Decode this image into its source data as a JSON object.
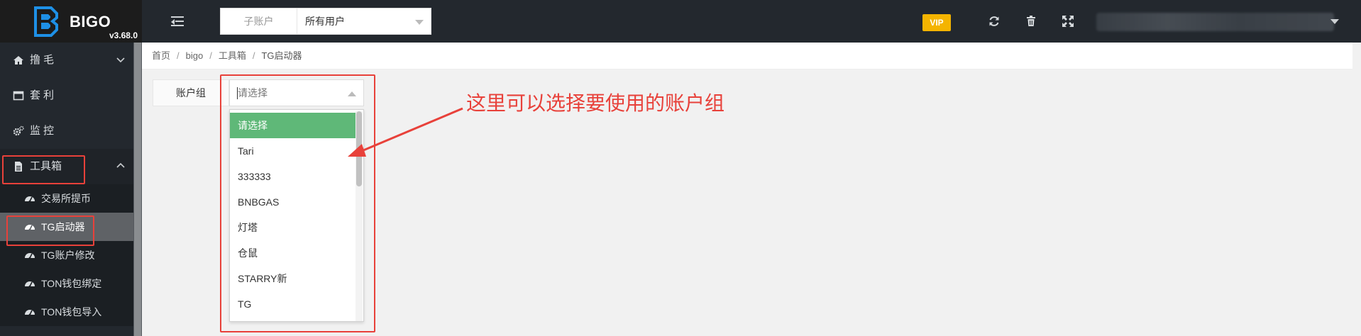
{
  "app": {
    "logo_text": "BIGO",
    "version": "v3.68.0"
  },
  "header": {
    "account_select": {
      "label": "子账户",
      "value": "所有用户"
    },
    "vip_badge": "VIP",
    "icons": [
      "refresh-icon",
      "trash-icon",
      "fullscreen-icon"
    ]
  },
  "sidebar": {
    "items": [
      {
        "label": "撸毛",
        "icon": "home-icon",
        "chevron": "down"
      },
      {
        "label": "套利",
        "icon": "window-icon"
      },
      {
        "label": "监控",
        "icon": "gears-icon"
      },
      {
        "label": "工具箱",
        "icon": "file-icon",
        "chevron": "up",
        "open": true
      }
    ],
    "sub_items": [
      {
        "label": "交易所提币",
        "icon": "dashboard-icon"
      },
      {
        "label": "TG启动器",
        "icon": "dashboard-icon",
        "active": true
      },
      {
        "label": "TG账户修改",
        "icon": "dashboard-icon"
      },
      {
        "label": "TON钱包绑定",
        "icon": "dashboard-icon"
      },
      {
        "label": "TON钱包导入",
        "icon": "dashboard-icon"
      }
    ]
  },
  "breadcrumb": [
    "首页",
    "bigo",
    "工具箱",
    "TG启动器"
  ],
  "form": {
    "account_group_label": "账户组",
    "account_group_placeholder": "请选择",
    "options": [
      "请选择",
      "Tari",
      "333333",
      "BNBGAS",
      "灯塔",
      "仓鼠",
      "STARRY新",
      "TG"
    ],
    "selected_index": 0
  },
  "annotation": {
    "text": "这里可以选择要使用的账户组",
    "color": "#e8413a"
  },
  "colors": {
    "topbar": "#23282e",
    "sidebar": "#23282e",
    "selected_option": "#5fb878",
    "vip": "#f4b400",
    "highlight": "#e8413a"
  }
}
